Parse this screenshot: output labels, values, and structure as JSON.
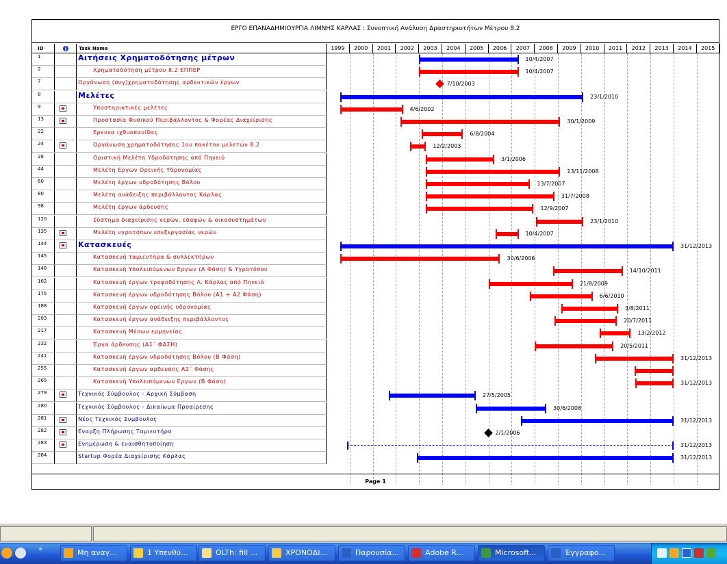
{
  "report": {
    "title": "ΕΡΓΟ ΕΠΑΝΑΔΗΜΙΟΥΡΓΙΑ ΛΙΜΝΗΣ ΚΑΡΛΑΣ : Συνοπτική  Ανάλυση Δραστηριοτήτων Μέτρου 8.2",
    "footer": "Page 1",
    "columns": {
      "id": "ID",
      "indicator": "info-icon",
      "task_name": "Task Name"
    },
    "years": [
      "1999",
      "2000",
      "2001",
      "2002",
      "2003",
      "2004",
      "2005",
      "2006",
      "2007",
      "2008",
      "2009",
      "2010",
      "2011",
      "2012",
      "2013",
      "2014",
      "2015"
    ]
  },
  "tasks": [
    {
      "id": "1",
      "name": "Αιτήσεις Χρηματοδότησης μέτρων",
      "style": "sum",
      "note": false,
      "bar": {
        "s": 2003.0,
        "e": 2007.3,
        "color": "blue",
        "label": "10/4/2007"
      }
    },
    {
      "id": "2",
      "name": "Χρηματοδότηση μέτρου 8.2 ΕΠΠΕΡ",
      "style": "sub",
      "indent": true,
      "note": false,
      "bar": {
        "s": 2003.0,
        "e": 2007.3,
        "color": "red",
        "label": "10/4/2007"
      }
    },
    {
      "id": "7",
      "name": "Οργάνωση (συγ)χρηματοδότησης αρδευτικών έργων",
      "style": "sub",
      "note": false,
      "milestone": {
        "at": 2003.9,
        "color": "red",
        "label": "7/10/2003"
      }
    },
    {
      "id": "8",
      "name": "Μελέτες",
      "style": "sum",
      "note": false,
      "bar": {
        "s": 1999.6,
        "e": 2010.1,
        "color": "blue",
        "label": "23/1/2010"
      }
    },
    {
      "id": "9",
      "name": "Υποστηρικτικές μελέτες",
      "style": "sub",
      "indent": true,
      "note": true,
      "bar": {
        "s": 1999.6,
        "e": 2002.3,
        "color": "red",
        "label": "4/6/2002"
      }
    },
    {
      "id": "13",
      "name": "Προστασία Φυσικού Περιβάλλοντος & Φορέας Διαχείρισης",
      "style": "sub",
      "indent": true,
      "note": true,
      "bar": {
        "s": 2002.2,
        "e": 2009.1,
        "color": "red",
        "label": "30/1/2009"
      }
    },
    {
      "id": "22",
      "name": "Ερευνα ιχθυοπανίδας",
      "style": "sub",
      "indent": true,
      "note": false,
      "bar": {
        "s": 2003.1,
        "e": 2004.9,
        "color": "red",
        "label": "6/8/2004"
      }
    },
    {
      "id": "24",
      "name": "Οργάνωση χρηματοδότησης 1ου πακέτου μελετών 8.2",
      "style": "sub",
      "indent": true,
      "note": true,
      "bar": {
        "s": 2002.6,
        "e": 2003.3,
        "color": "red",
        "label": "12/2/2003"
      }
    },
    {
      "id": "28",
      "name": "Οριστική Μελέτη Υδροδότησης από Πηνειό",
      "style": "sub",
      "indent": true,
      "note": false,
      "bar": {
        "s": 2003.3,
        "e": 2006.25,
        "color": "red",
        "label": "3/1/2006"
      }
    },
    {
      "id": "44",
      "name": "Μελέτη Εργων Ορεινής Υδρονομίας",
      "style": "sub",
      "indent": true,
      "note": false,
      "bar": {
        "s": 2003.3,
        "e": 2009.1,
        "color": "red",
        "label": "13/11/2008"
      }
    },
    {
      "id": "60",
      "name": "Μελέτη έργων υδροδότησης Βόλου",
      "style": "sub",
      "indent": true,
      "note": false,
      "bar": {
        "s": 2003.3,
        "e": 2007.8,
        "color": "red",
        "label": "13/7/2007"
      }
    },
    {
      "id": "80",
      "name": "Μελέτη ανάδειξης περιβάλλοντος Κάρλας",
      "style": "sub",
      "indent": true,
      "note": false,
      "bar": {
        "s": 2003.3,
        "e": 2008.85,
        "color": "red",
        "label": "31/7/2008"
      }
    },
    {
      "id": "98",
      "name": "Μελέτη έργων άρδευσης",
      "style": "sub",
      "indent": true,
      "note": false,
      "bar": {
        "s": 2003.3,
        "e": 2007.95,
        "color": "red",
        "label": "12/9/2007"
      }
    },
    {
      "id": "120",
      "name": "Σύστημα διαχείρισης νερών, εδαφών & οικοσυστημάτων",
      "style": "sub",
      "indent": true,
      "note": false,
      "bar": {
        "s": 2008.05,
        "e": 2010.1,
        "color": "red",
        "label": "23/1/2010"
      }
    },
    {
      "id": "135",
      "name": "Μελέτη υγροτόπων επεξεργασίας νερών",
      "style": "sub",
      "indent": true,
      "note": true,
      "bar": {
        "s": 2006.3,
        "e": 2007.3,
        "color": "red",
        "label": "10/4/2007"
      }
    },
    {
      "id": "144",
      "name": "Κατασκευές",
      "style": "sum",
      "note": true,
      "bar": {
        "s": 1999.6,
        "e": 2014.0,
        "color": "blue",
        "label": "31/12/2013"
      }
    },
    {
      "id": "145",
      "name": "Κατασκευή ταμιευτήρα & συλλεκτήρων",
      "style": "sub",
      "indent": true,
      "note": false,
      "bar": {
        "s": 1999.6,
        "e": 2006.5,
        "color": "red",
        "label": "30/6/2006"
      }
    },
    {
      "id": "148",
      "name": "Κατασκευή Υπολειπόμενων Εργων (Α Φάση)  & Υγροτόπου",
      "style": "sub",
      "indent": true,
      "note": false,
      "bar": {
        "s": 2008.8,
        "e": 2011.8,
        "color": "red",
        "label": "14/10/2011"
      }
    },
    {
      "id": "162",
      "name": "Κατασκευή έργων τροφοδότησης Λ. Κάρλας από Πηνειό",
      "style": "sub",
      "indent": true,
      "note": false,
      "bar": {
        "s": 2006.0,
        "e": 2009.65,
        "color": "red",
        "label": "21/8/2009"
      }
    },
    {
      "id": "175",
      "name": "Κατασκευή έργων υδροδότησης Βόλου (Α1 + Α2  Φάση)",
      "style": "sub",
      "indent": true,
      "note": false,
      "bar": {
        "s": 2007.8,
        "e": 2010.5,
        "color": "red",
        "label": "6/6/2010"
      }
    },
    {
      "id": "188",
      "name": "Κατασκευή έργων ορεινής υδρονομίας",
      "style": "sub",
      "indent": true,
      "note": false,
      "bar": {
        "s": 2009.15,
        "e": 2011.6,
        "color": "red",
        "label": "3/8/2011"
      }
    },
    {
      "id": "203",
      "name": "Κατασκευή έργων ανάδειξης περιβάλλοντος",
      "style": "sub",
      "indent": true,
      "note": false,
      "bar": {
        "s": 2008.85,
        "e": 2011.55,
        "color": "red",
        "label": "20/7/2011"
      }
    },
    {
      "id": "217",
      "name": "Κατασκευή Μέσων ερμηνείας",
      "style": "sub",
      "indent": true,
      "note": false,
      "bar": {
        "s": 2010.8,
        "e": 2012.15,
        "color": "red",
        "label": "13/2/2012"
      }
    },
    {
      "id": "232",
      "name": "Έργα άρδευσης (Α1΄ ΦΑΣΗ)",
      "style": "sub",
      "indent": true,
      "note": false,
      "bar": {
        "s": 2008.0,
        "e": 2011.4,
        "color": "red",
        "label": "20/5/2011"
      }
    },
    {
      "id": "241",
      "name": "Κατασκευή έργων υδροδότησης Βόλου (Β Φάση)",
      "style": "sub",
      "indent": true,
      "note": false,
      "bar": {
        "s": 2010.6,
        "e": 2014.0,
        "color": "red",
        "label": "31/12/2013"
      }
    },
    {
      "id": "255",
      "name": "Κατασκευή έργων αρδευσης  Α2΄ Φάσης",
      "style": "sub",
      "indent": true,
      "note": false,
      "bar": {
        "s": 2012.3,
        "e": 2014.0,
        "color": "red",
        "label": ""
      }
    },
    {
      "id": "265",
      "name": "Κατασκευή Υπολειπόμενων Εργων (Β Φάση)",
      "style": "sub",
      "indent": true,
      "note": false,
      "bar": {
        "s": 2012.35,
        "e": 2014.0,
        "color": "red",
        "label": "31/12/2013"
      }
    },
    {
      "id": "279",
      "name": "Τεχνικός Σύμβουλος - Αρχική Σύμβαση",
      "style": "top",
      "note": true,
      "bar": {
        "s": 2001.7,
        "e": 2005.45,
        "color": "blue",
        "label": "27/5/2005"
      }
    },
    {
      "id": "280",
      "name": "Τεχνικός Σύμβουλος - Δικαίωμα Προαίρεσης",
      "style": "top",
      "note": false,
      "bar": {
        "s": 2005.45,
        "e": 2008.5,
        "color": "blue",
        "label": "30/6/2008"
      }
    },
    {
      "id": "281",
      "name": "Νέος Τεχνικός Συμβουλος",
      "style": "top",
      "note": true,
      "bar": {
        "s": 2007.4,
        "e": 2014.0,
        "color": "blue",
        "label": "31/12/2013"
      }
    },
    {
      "id": "282",
      "name": "Εναρξη Πλήρωσης Ταμιευτήρα",
      "style": "top",
      "note": true,
      "milestone": {
        "at": 2006.0,
        "color": "black",
        "label": "2/1/2006"
      }
    },
    {
      "id": "283",
      "name": "Ενημέρωση & ευαισθητοποίηση",
      "style": "top",
      "note": true,
      "dotted": {
        "s": 1999.9,
        "e": 2014.0,
        "label": "31/12/2013"
      }
    },
    {
      "id": "284",
      "name": "Startup Φορέα Διαχείρισης Κάρλας",
      "style": "top",
      "note": false,
      "bar": {
        "s": 2002.9,
        "e": 2014.0,
        "color": "blue",
        "label": "31/12/2013"
      }
    }
  ],
  "taskbar": {
    "buttons": [
      {
        "label": "Μη αναγ...",
        "icon": "clock-icon"
      },
      {
        "label": "1 Υπενθύ...",
        "icon": "bell-icon"
      },
      {
        "label": "OLTh: fill ...",
        "icon": "mail-icon"
      },
      {
        "label": "ΧΡΟΝΟΔΙ...",
        "icon": "folder-icon"
      },
      {
        "label": "Παρουσία...",
        "icon": "word-icon"
      },
      {
        "label": "Adobe R...",
        "icon": "pdf-icon"
      },
      {
        "label": "Microsoft...",
        "icon": "project-icon"
      },
      {
        "label": "Έγγραφο...",
        "icon": "word-icon"
      }
    ]
  }
}
